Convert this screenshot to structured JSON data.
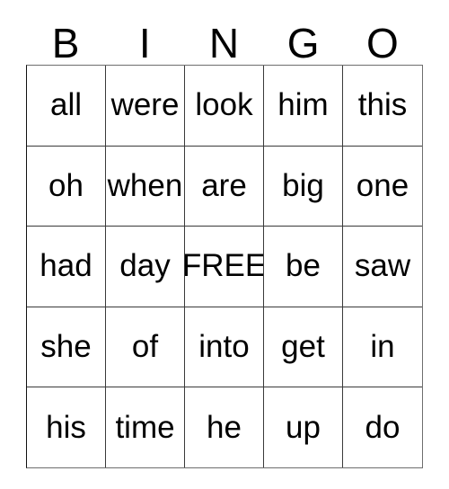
{
  "card": {
    "title": "BINGO",
    "header": [
      "B",
      "I",
      "N",
      "G",
      "O"
    ],
    "free_space_label": "FREE",
    "free_space_position": {
      "row": 2,
      "col": 2
    },
    "columns": 5,
    "rows": 5,
    "colors": {
      "background": "#ffffff",
      "text": "#000000",
      "grid_line": "#3a3a3a",
      "grid_border": "#6e6e6e"
    },
    "grid": [
      [
        "all",
        "were",
        "look",
        "him",
        "this"
      ],
      [
        "oh",
        "when",
        "are",
        "big",
        "one"
      ],
      [
        "had",
        "day",
        "FREE",
        "be",
        "saw"
      ],
      [
        "she",
        "of",
        "into",
        "get",
        "in"
      ],
      [
        "his",
        "time",
        "he",
        "up",
        "do"
      ]
    ]
  }
}
